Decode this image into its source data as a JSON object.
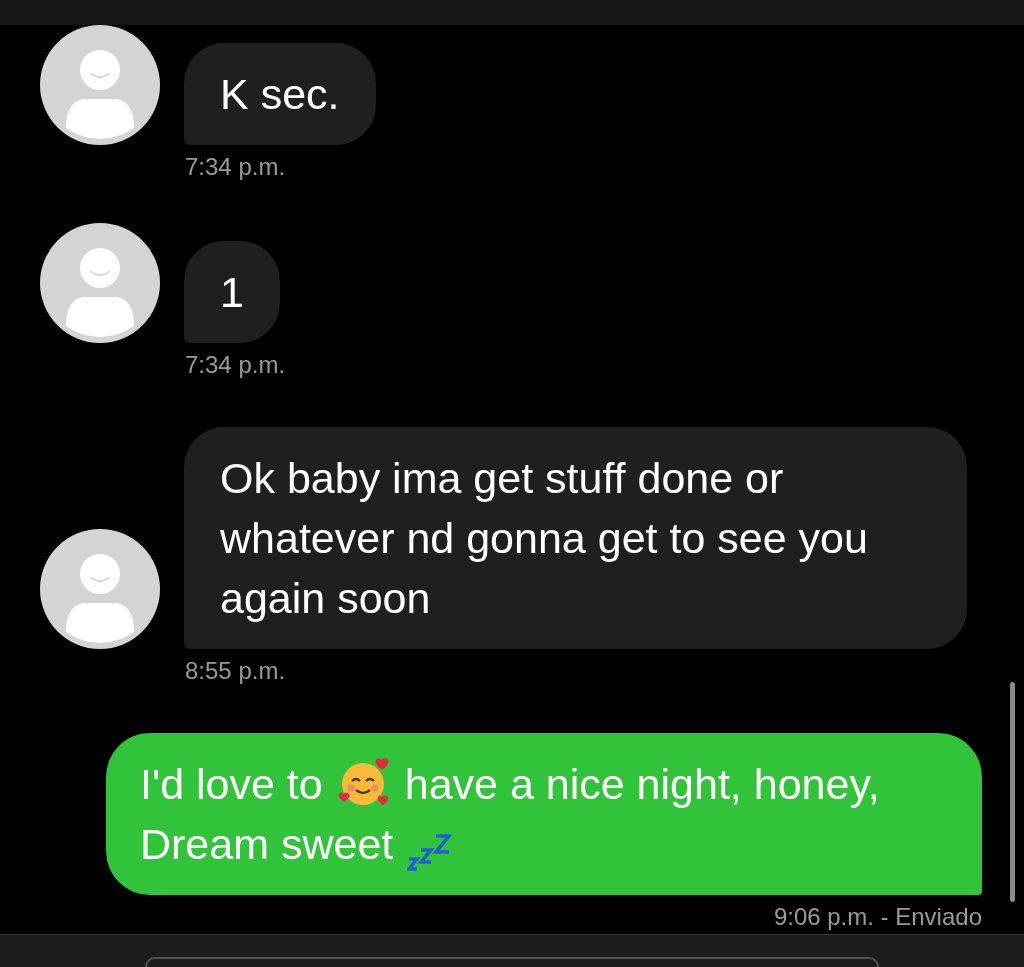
{
  "messages": [
    {
      "kind": "received",
      "parts": [
        {
          "kind": "text",
          "text": "K sec."
        }
      ],
      "time": "7:34 p.m."
    },
    {
      "kind": "received",
      "parts": [
        {
          "kind": "text",
          "text": "1"
        }
      ],
      "time": "7:34 p.m."
    },
    {
      "kind": "received",
      "parts": [
        {
          "kind": "text",
          "text": "Ok baby ima get stuff done or whatever nd gonna get to see you again soon"
        }
      ],
      "time": "8:55 p.m."
    },
    {
      "kind": "sent",
      "parts": [
        {
          "kind": "text",
          "text": "I'd love to"
        },
        {
          "kind": "emoji-hearts"
        },
        {
          "kind": "text",
          "text": "have a nice night, honey, Dream sweet"
        },
        {
          "kind": "emoji-zzz"
        }
      ],
      "time": "9:06 p.m. - Enviado"
    }
  ]
}
